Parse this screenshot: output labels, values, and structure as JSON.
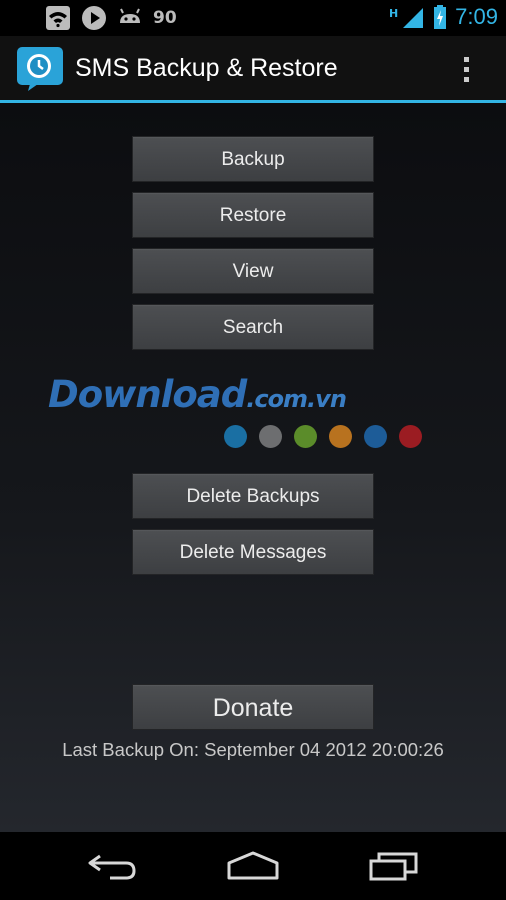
{
  "status_bar": {
    "notification_count": "90",
    "network_type": "H",
    "time": "7:09"
  },
  "app": {
    "title": "SMS Backup & Restore"
  },
  "buttons": {
    "backup": "Backup",
    "restore": "Restore",
    "view": "View",
    "search": "Search",
    "delete_backups": "Delete Backups",
    "delete_messages": "Delete Messages",
    "donate": "Donate"
  },
  "watermark": {
    "brand": "Download",
    "domain": ".com.vn",
    "dot_colors": [
      "#1a6fa3",
      "#6d6e70",
      "#5b8c2a",
      "#b8721f",
      "#1d5c98",
      "#9b1c22"
    ]
  },
  "last_backup": "Last Backup On: September 04 2012 20:00:26",
  "colors": {
    "accent": "#33b5e5",
    "button_bg": "#46484b",
    "background": "#15171b"
  },
  "icons": {
    "status_left": [
      "wifi-icon",
      "play-store-icon",
      "android-debug-icon"
    ],
    "status_right": [
      "signal-icon",
      "battery-charging-icon"
    ],
    "nav": [
      "back-icon",
      "home-icon",
      "recent-apps-icon"
    ]
  }
}
